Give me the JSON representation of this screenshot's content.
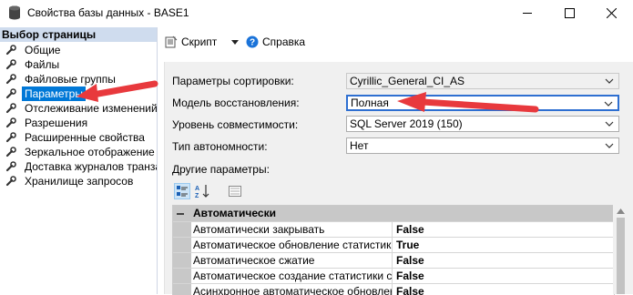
{
  "window": {
    "title": "Свойства базы данных - BASE1",
    "icon": "database-icon"
  },
  "left_pane": {
    "header": "Выбор страницы",
    "items": [
      {
        "label": "Общие"
      },
      {
        "label": "Файлы"
      },
      {
        "label": "Файловые группы"
      },
      {
        "label": "Параметры",
        "selected": true
      },
      {
        "label": "Отслеживание изменений"
      },
      {
        "label": "Разрешения"
      },
      {
        "label": "Расширенные свойства"
      },
      {
        "label": "Зеркальное отображение"
      },
      {
        "label": "Доставка журналов транзакций"
      },
      {
        "label": "Хранилище запросов"
      }
    ]
  },
  "toolbar": {
    "script_label": "Скрипт",
    "help_label": "Справка"
  },
  "options": {
    "collation": {
      "label": "Параметры сортировки:",
      "value": "Cyrillic_General_CI_AS"
    },
    "recovery": {
      "label": "Модель восстановления:",
      "value": "Полная"
    },
    "compat": {
      "label": "Уровень совместимости:",
      "value": "SQL Server 2019 (150)"
    },
    "containment": {
      "label": "Тип автономности:",
      "value": "Нет"
    },
    "other_label": "Другие параметры:"
  },
  "grid": {
    "category": "Автоматически",
    "rows": [
      {
        "name": "Автоматически закрывать",
        "value": "False"
      },
      {
        "name": "Автоматическое обновление статистики",
        "value": "True"
      },
      {
        "name": "Автоматическое сжатие",
        "value": "False"
      },
      {
        "name": "Автоматическое создание статистики с добавочным обновлением",
        "value": "False"
      },
      {
        "name": "Асинхронное автоматическое обновление статистики",
        "value": "False"
      }
    ]
  },
  "colors": {
    "selection": "#0078d7",
    "annotation_arrow": "#e8393d",
    "focus_border": "#2e6fd1"
  }
}
